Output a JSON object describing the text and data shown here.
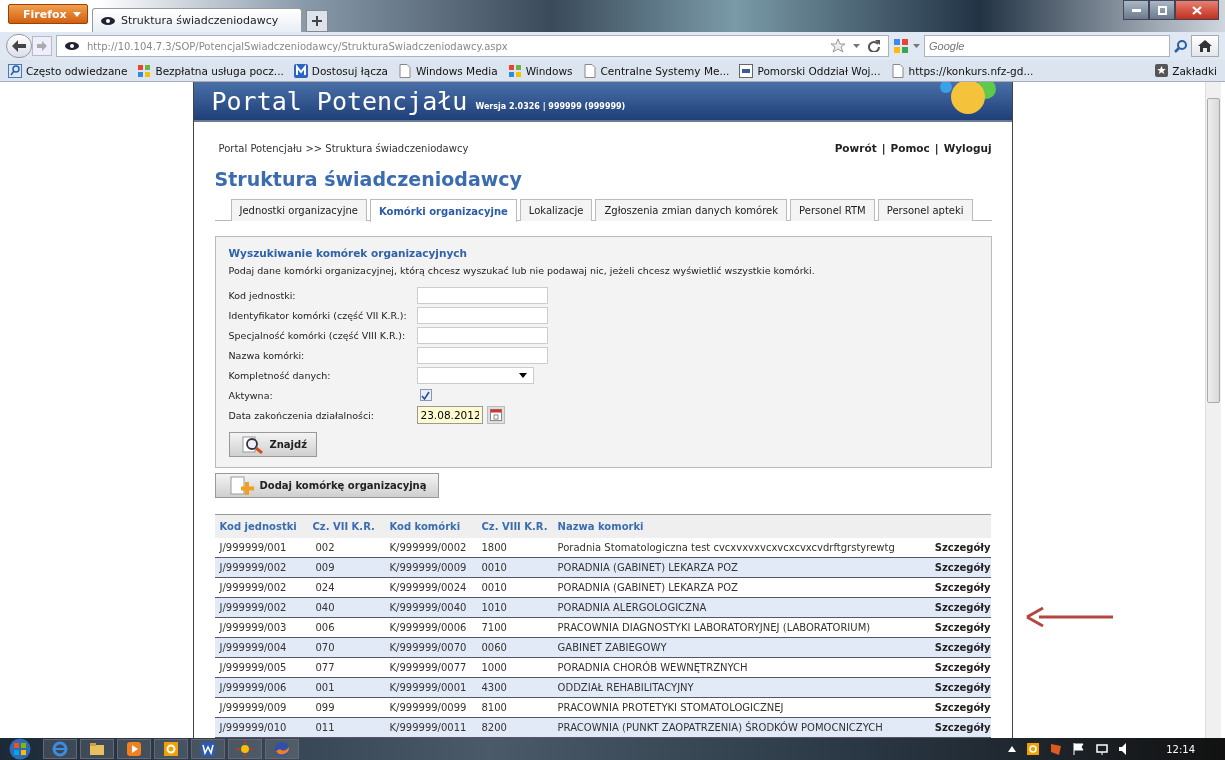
{
  "browser": {
    "menu_button": "Firefox",
    "tab_title": "Struktura świadczeniodawcy",
    "url": "http://10.104.7.3/SOP/PotencjalSwiadczeniodawcy/StrukturaSwiadczeniodawcy.aspx",
    "search_placeholder": "Google",
    "bookmarks": [
      {
        "label": "Często odwiedzane",
        "kind": "history"
      },
      {
        "label": "Bezpłatna usługa pocz...",
        "kind": "windows"
      },
      {
        "label": "Dostosuj łącza",
        "kind": "custom"
      },
      {
        "label": "Windows Media",
        "kind": "page"
      },
      {
        "label": "Windows",
        "kind": "windows"
      },
      {
        "label": "Centralne Systemy Me...",
        "kind": "page"
      },
      {
        "label": "Pomorski Oddział Woj...",
        "kind": "site"
      },
      {
        "label": "https://konkurs.nfz-gd...",
        "kind": "page"
      }
    ],
    "bookmarks_menu": "Zakładki"
  },
  "page": {
    "title": "Portal Potencjału",
    "version": "Wersja 2.0326 | 999999 (999999)",
    "breadcrumb": "Portal Potencjału >> Struktura świadczeniodawcy",
    "links": [
      "Powrót",
      "Pomoc",
      "Wyloguj"
    ],
    "link_separator": "|",
    "heading": "Struktura świadczeniodawcy",
    "tabs": [
      {
        "label": "Jednostki organizacyjne",
        "selected": false
      },
      {
        "label": "Komórki organizacyjne",
        "selected": true
      },
      {
        "label": "Lokalizacje",
        "selected": false
      },
      {
        "label": "Zgłoszenia zmian danych komórek",
        "selected": false
      },
      {
        "label": "Personel RTM",
        "selected": false
      },
      {
        "label": "Personel apteki",
        "selected": false
      }
    ],
    "search": {
      "title": "Wyszukiwanie komórek organizacyjnych",
      "description": "Podaj dane komórki organizacyjnej, którą chcesz wyszukać lub nie podawaj nic, jeżeli chcesz wyświetlić wszystkie komórki.",
      "fields": [
        {
          "label": "Kod jednostki:",
          "kind": "text"
        },
        {
          "label": "Identyfikator komórki (część VII K.R.):",
          "kind": "text"
        },
        {
          "label": "Specjalność komórki (część VIII K.R.):",
          "kind": "text"
        },
        {
          "label": "Nazwa komórki:",
          "kind": "text"
        },
        {
          "label": "Kompletność danych:",
          "kind": "select"
        },
        {
          "label": "Aktywna:",
          "kind": "checkbox",
          "checked": true
        },
        {
          "label": "Data zakończenia działalności:",
          "kind": "date",
          "value": "23.08.2012"
        }
      ],
      "find_button": "Znajdź"
    },
    "add_button": "Dodaj komórkę organizacyjną",
    "table": {
      "columns": [
        "Kod jednostki",
        "Cz. VII K.R.",
        "Kod komórki",
        "Cz. VIII K.R.",
        "Nazwa komorki"
      ],
      "rows": [
        {
          "cells": [
            "J/999999/001",
            "002",
            "K/999999/0002",
            "1800",
            "Poradnia Stomatologiczna test cvcxvxvxvcxvcxcvxcvdrftgrstyrewtg"
          ],
          "action": "Szczegóły"
        },
        {
          "cells": [
            "J/999999/002",
            "009",
            "K/999999/0009",
            "0010",
            "PORADNIA (GABINET) LEKARZA POZ"
          ],
          "action": "Szczegóły"
        },
        {
          "cells": [
            "J/999999/002",
            "024",
            "K/999999/0024",
            "0010",
            "PORADNIA (GABINET) LEKARZA POZ"
          ],
          "action": "Szczegóły"
        },
        {
          "cells": [
            "J/999999/002",
            "040",
            "K/999999/0040",
            "1010",
            "PORADNIA ALERGOLOGICZNA"
          ],
          "action": "Szczegóły"
        },
        {
          "cells": [
            "J/999999/003",
            "006",
            "K/999999/0006",
            "7100",
            "PRACOWNIA DIAGNOSTYKI LABORATORYJNEJ (LABORATORIUM)"
          ],
          "action": "Szczegóły"
        },
        {
          "cells": [
            "J/999999/004",
            "070",
            "K/999999/0070",
            "0060",
            "GABINET ZABIEGOWY"
          ],
          "action": "Szczegóły"
        },
        {
          "cells": [
            "J/999999/005",
            "077",
            "K/999999/0077",
            "1000",
            "PORADNIA CHORÓB WEWNĘTRZNYCH"
          ],
          "action": "Szczegóły"
        },
        {
          "cells": [
            "J/999999/006",
            "001",
            "K/999999/0001",
            "4300",
            "ODDZIAŁ REHABILITACYJNY"
          ],
          "action": "Szczegóły"
        },
        {
          "cells": [
            "J/999999/009",
            "099",
            "K/999999/0099",
            "8100",
            "PRACOWNIA PROTETYKI STOMATOLOGICZNEJ"
          ],
          "action": "Szczegóły"
        },
        {
          "cells": [
            "J/999999/010",
            "011",
            "K/999999/0011",
            "8200",
            "PRACOWNIA (PUNKT ZAOPATRZENIA) ŚRODKÓW POMOCNICZYCH"
          ],
          "action": "Szczegóły"
        }
      ]
    }
  },
  "taskbar": {
    "time": "12:14"
  }
}
